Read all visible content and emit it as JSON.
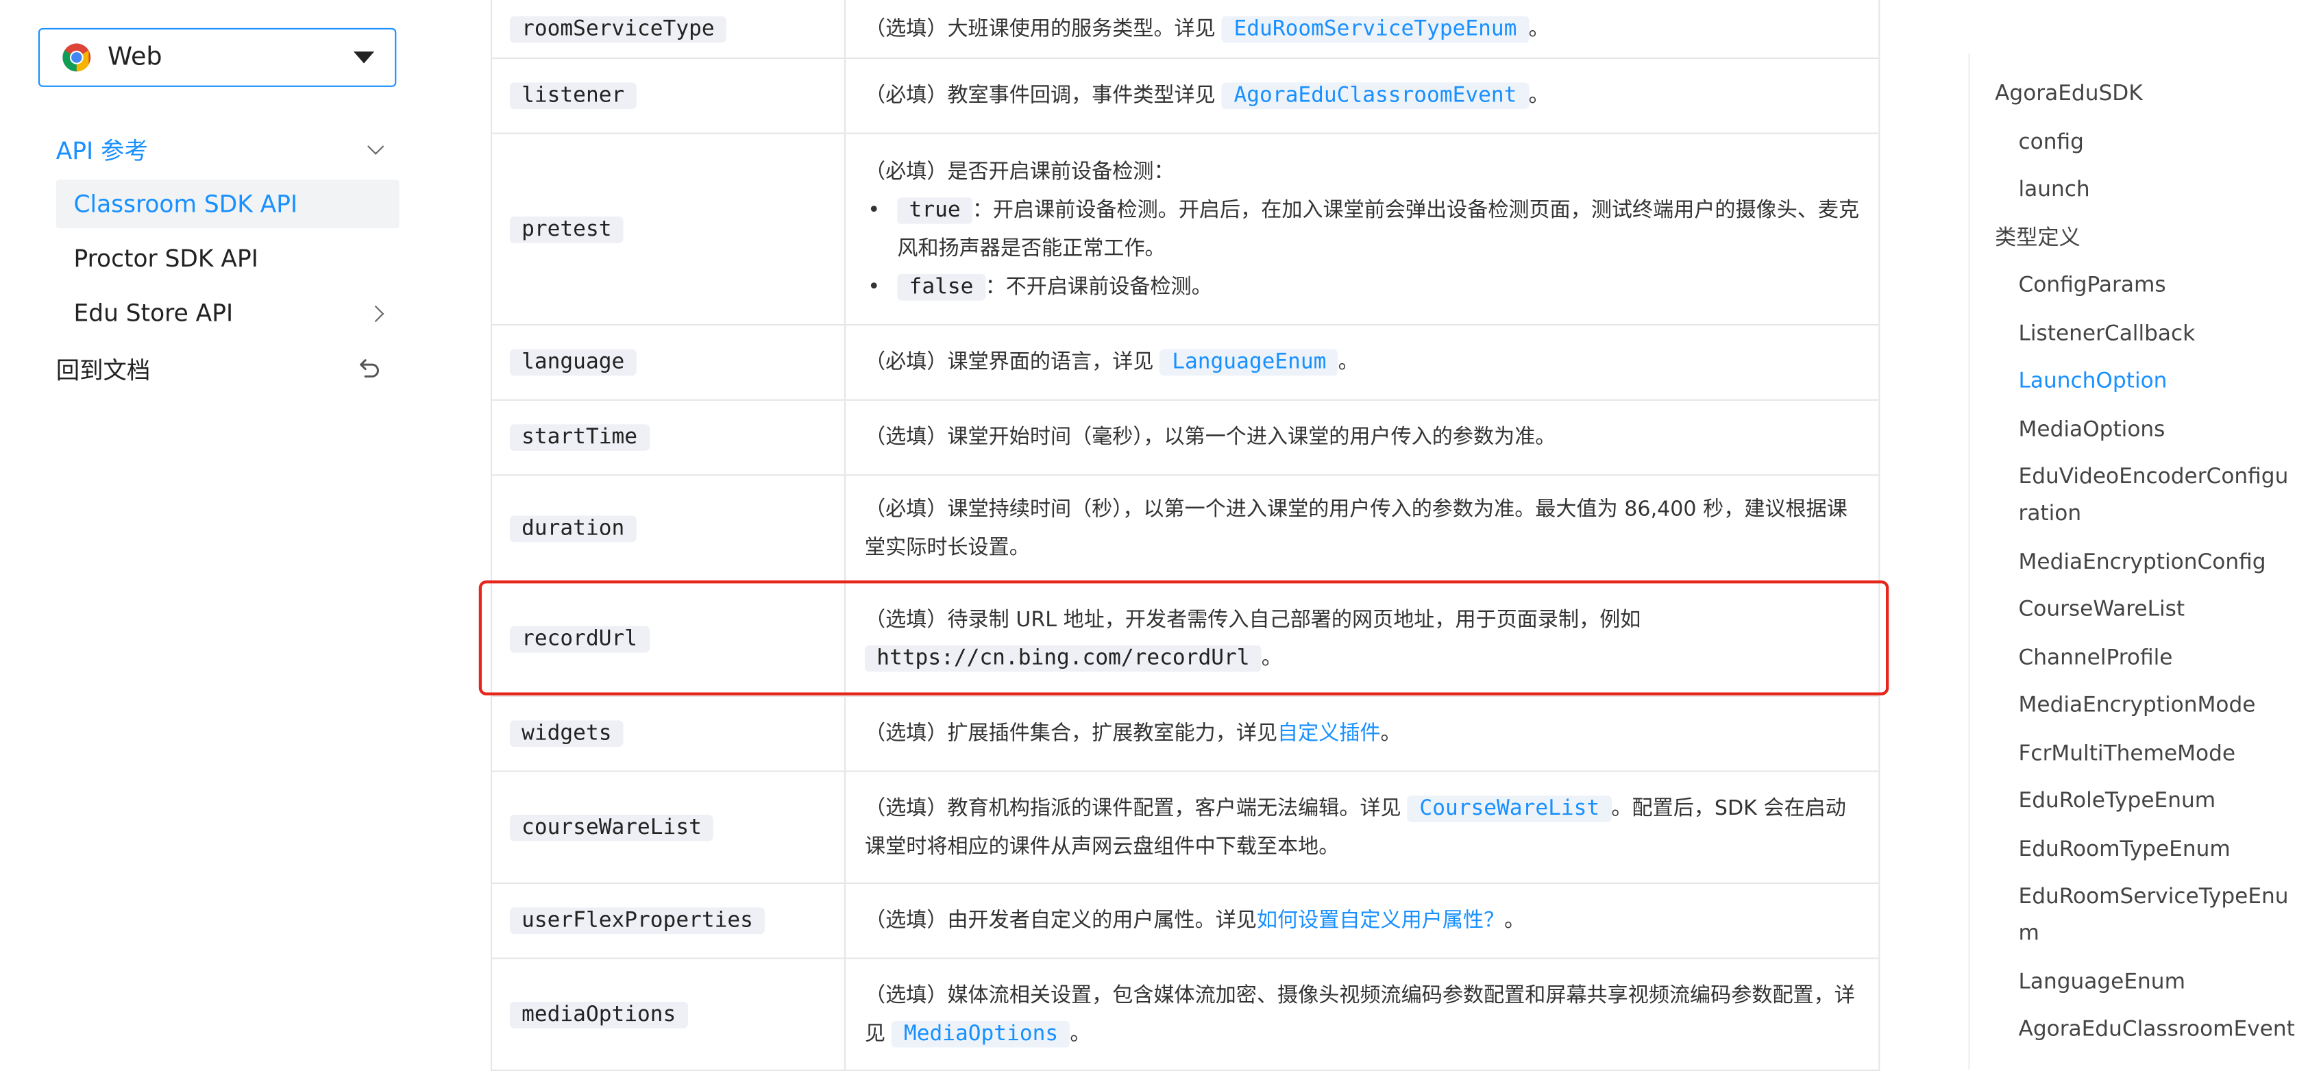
{
  "sidebar": {
    "platform_select": {
      "label": "Web",
      "icon": "chrome-icon"
    },
    "nav": {
      "section_label": "API 参考",
      "items": [
        {
          "label": "Classroom SDK API",
          "active": true
        },
        {
          "label": "Proctor SDK API"
        },
        {
          "label": "Edu Store API"
        }
      ],
      "back_label": "回到文档"
    }
  },
  "table": {
    "rows": [
      {
        "name": "roomServiceType",
        "desc_a": "（选填）大班课使用的服务类型。详见 ",
        "code": "EduRoomServiceTypeEnum",
        "desc_b": "。"
      },
      {
        "name": "listener",
        "desc_a": "（必填）教室事件回调，事件类型详见 ",
        "code": "AgoraEduClassroomEvent",
        "desc_b": "。"
      },
      {
        "name": "pretest",
        "intro": "（必填）是否开启课前设备检测：",
        "bullets": [
          {
            "code": "true",
            "text": "：开启课前设备检测。开启后，在加入课堂前会弹出设备检测页面，测试终端用户的摄像头、麦克风和扬声器是否能正常工作。"
          },
          {
            "code": "false",
            "text": "：不开启课前设备检测。"
          }
        ]
      },
      {
        "name": "language",
        "desc_a": "（必填）课堂界面的语言，详见 ",
        "code": "LanguageEnum",
        "desc_b": "。"
      },
      {
        "name": "startTime",
        "desc": "（选填）课堂开始时间（毫秒），以第一个进入课堂的用户传入的参数为准。"
      },
      {
        "name": "duration",
        "desc": "（必填）课堂持续时间（秒），以第一个进入课堂的用户传入的参数为准。最大值为 86,400 秒，建议根据课堂实际时长设置。"
      },
      {
        "name": "recordUrl",
        "desc": "（选填）待录制 URL 地址，开发者需传入自己部署的网页地址，用于页面录制，例如",
        "code": "https://cn.bing.com/recordUrl",
        "desc_b": "。"
      },
      {
        "name": "widgets",
        "desc_a": "（选填）扩展插件集合，扩展教室能力，详见",
        "link": "自定义插件",
        "desc_b": "。"
      },
      {
        "name": "courseWareList",
        "desc_a": "（选填）教育机构指派的课件配置，客户端无法编辑。详见 ",
        "code": "CourseWareList",
        "desc_b": "。配置后，SDK 会在启动课堂时将相应的课件从声网云盘组件中下载至本地。"
      },
      {
        "name": "userFlexProperties",
        "desc_a": "（选填）由开发者自定义的用户属性。详见",
        "link": "如何设置自定义用户属性？",
        "desc_b": "。"
      },
      {
        "name": "mediaOptions",
        "desc_a": "（选填）媒体流相关设置，包含媒体流加密、摄像头视频流编码参数配置和屏幕共享视频流编码参数配置，详见 ",
        "code": "MediaOptions",
        "desc_b": "。"
      }
    ]
  },
  "toc": {
    "items": [
      {
        "label": "AgoraEduSDK"
      },
      {
        "label": "config"
      },
      {
        "label": "launch"
      },
      {
        "label": "类型定义"
      },
      {
        "label": "ConfigParams"
      },
      {
        "label": "ListenerCallback"
      },
      {
        "label": "LaunchOption"
      },
      {
        "label": "MediaOptions"
      },
      {
        "label": "EduVideoEncoderConfiguration"
      },
      {
        "label": "MediaEncryptionConfig"
      },
      {
        "label": "CourseWareList"
      },
      {
        "label": "ChannelProfile"
      },
      {
        "label": "MediaEncryptionMode"
      },
      {
        "label": "FcrMultiThemeMode"
      },
      {
        "label": "EduRoleTypeEnum"
      },
      {
        "label": "EduRoomTypeEnum"
      },
      {
        "label": "EduRoomServiceTypeEnum"
      },
      {
        "label": "LanguageEnum"
      },
      {
        "label": "AgoraEduClassroomEvent"
      }
    ]
  },
  "colors": {
    "accent": "#1890ff",
    "highlight_border": "#e5261a"
  }
}
